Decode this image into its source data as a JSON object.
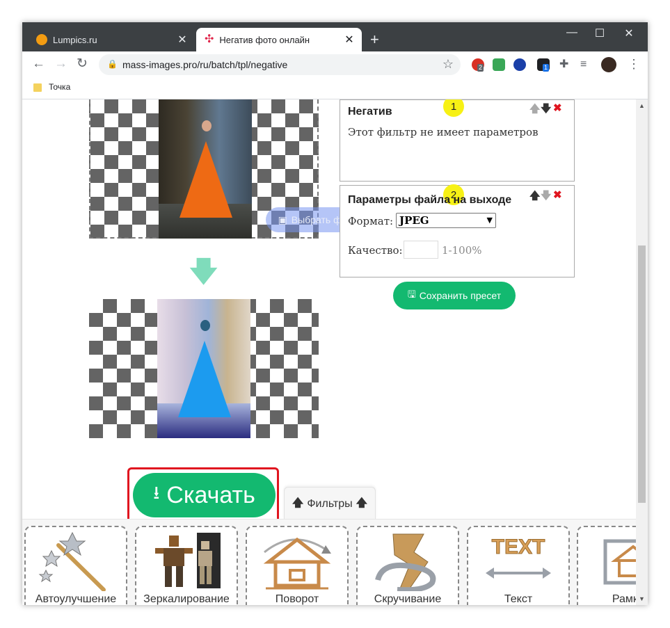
{
  "browser": {
    "tabs": [
      {
        "title": "Lumpics.ru",
        "icon": "orange-circle-favicon"
      },
      {
        "title": "Негатив фото онлайн",
        "icon": "red-star-favicon"
      }
    ],
    "new_tab": "+",
    "window_controls": {
      "minimize": "—",
      "maximize": "☐",
      "close": "✕"
    },
    "url": "mass-images.pro/ru/batch/tpl/negative",
    "extension_badges": {
      "opera": "2",
      "box": "1"
    },
    "bookmark": "Точка"
  },
  "preview": {
    "choose_files_label": "Выбрать файлы",
    "arrow": "🡇"
  },
  "filters": [
    {
      "title": "Негатив",
      "number": "1",
      "text": "Этот фильтр не имеет параметров"
    },
    {
      "title": "Параметры файла на выходе",
      "number": "2",
      "format_label": "Формат:",
      "format_value": "JPEG",
      "quality_label": "Качество:",
      "quality_hint": "1-100%"
    }
  ],
  "controls": {
    "up": "🡅",
    "down": "🡇",
    "remove": "✖"
  },
  "save_preset_label": "Сохранить пресет",
  "download_label": "Скачать",
  "filters_tab_label": "Фильтры",
  "filter_tiles": [
    {
      "label": "Автоулучшение",
      "icon": "magic-wand-icon"
    },
    {
      "label": "Зеркалирование",
      "icon": "mirror-figure-icon"
    },
    {
      "label": "Поворот",
      "icon": "rotate-house-icon"
    },
    {
      "label": "Скручивание",
      "icon": "twist-icon"
    },
    {
      "label": "Текст",
      "icon": "text-icon",
      "icon_text": "TEXT"
    },
    {
      "label": "Рамка",
      "icon": "frame-icon"
    }
  ]
}
